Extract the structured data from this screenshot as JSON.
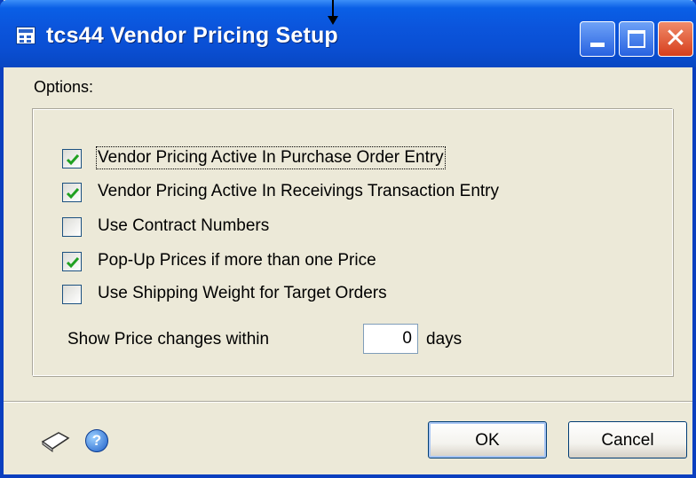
{
  "window": {
    "title": "tcs44 Vendor Pricing Setup",
    "icon": "window-app-icon"
  },
  "titlebar_buttons": {
    "minimize": "minimize-icon",
    "maximize": "maximize-icon",
    "close": "✕"
  },
  "options": {
    "label": "Options:",
    "checkboxes": [
      {
        "label": "Vendor Pricing Active In Purchase Order Entry",
        "checked": true
      },
      {
        "label": "Vendor Pricing Active In Receivings Transaction Entry",
        "checked": true
      },
      {
        "label": "Use Contract Numbers",
        "checked": false
      },
      {
        "label": "Pop-Up Prices if more than one Price",
        "checked": true
      },
      {
        "label": "Use Shipping Weight for Target Orders",
        "checked": false
      }
    ],
    "price_changes": {
      "label": "Show Price changes within",
      "value": "0",
      "unit": "days"
    }
  },
  "footer": {
    "help_glyph": "?",
    "ok_label": "OK",
    "cancel_label": "Cancel"
  },
  "colors": {
    "titlebar": "#0a4fd4",
    "dialog_bg": "#ece9d8",
    "check": "#21a121",
    "close_button": "#d63e1c"
  }
}
